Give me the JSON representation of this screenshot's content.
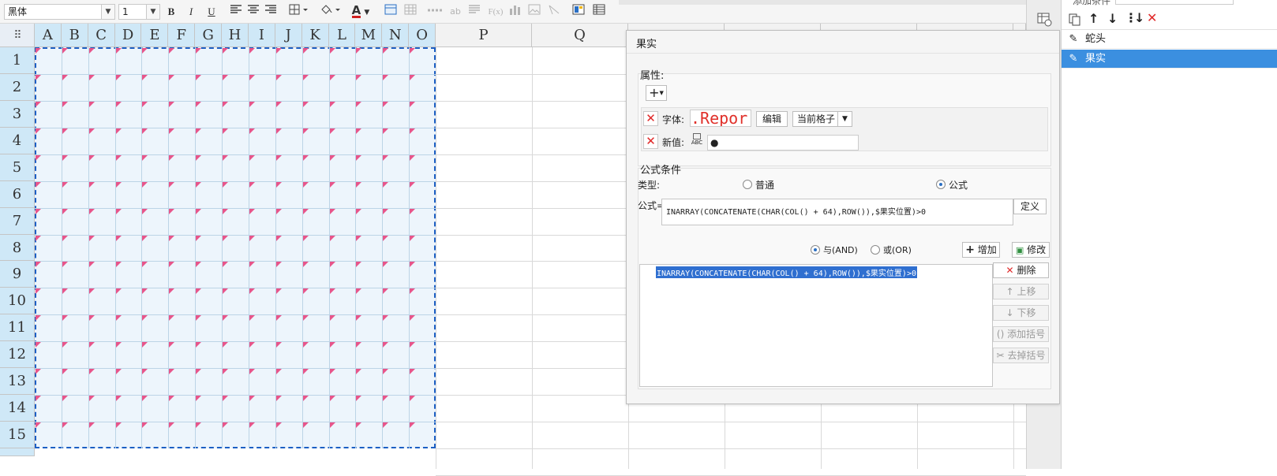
{
  "toolbar": {
    "font_name": "黑体",
    "font_size": "1",
    "bold": "B",
    "italic": "I",
    "underline": "U",
    "text_color_glyph": "A",
    "fx_glyph": "F(x)",
    "ab_glyph": "ab"
  },
  "sheet": {
    "corner_glyph": "⠿",
    "columns": [
      "A",
      "B",
      "C",
      "D",
      "E",
      "F",
      "G",
      "H",
      "I",
      "J",
      "K",
      "L",
      "M",
      "N",
      "O",
      "P",
      "Q"
    ],
    "rows": [
      "1",
      "2",
      "3",
      "4",
      "5",
      "6",
      "7",
      "8",
      "9",
      "10",
      "11",
      "12",
      "13",
      "14",
      "15"
    ]
  },
  "dialog": {
    "title": "果实",
    "properties": {
      "label": "属性:",
      "add_glyph": "+",
      "font_label": "字体:",
      "font_preview": ".Repor",
      "edit_label": "编辑",
      "scope_value": "当前格子",
      "newvalue_label": "新值:",
      "newvalue_icon_text": "ABC",
      "newvalue_value": "●"
    },
    "formula_condition": {
      "label": "公式条件",
      "type_label": "类型:",
      "type_normal": "普通",
      "type_formula": "公式",
      "formula_label": "公式=",
      "formula_value": "INARRAY(CONCATENATE(CHAR(COL() + 64),ROW()),$果实位置)>0",
      "define_label": "定义",
      "and_label": "与(AND)",
      "or_label": "或(OR)",
      "add_label": "增加",
      "modify_label": "修改",
      "condition_item": "INARRAY(CONCATENATE(CHAR(COL() + 64),ROW()),$果实位置)>0",
      "delete_label": "删除",
      "move_up_label": "上移",
      "move_down_label": "下移",
      "add_bracket_label": "添加括号",
      "remove_bracket_label": "去掉括号"
    }
  },
  "right_panel": {
    "header": "添加条件",
    "items": [
      "蛇头",
      "果实"
    ],
    "selected_item": "果实"
  },
  "colors": {
    "selection_fill": "#edf5fc",
    "selection_border": "#1c5fc4",
    "corner_marker": "#e8558a",
    "selected_list_item": "#3b8fe0",
    "delete_red": "#e02828"
  }
}
